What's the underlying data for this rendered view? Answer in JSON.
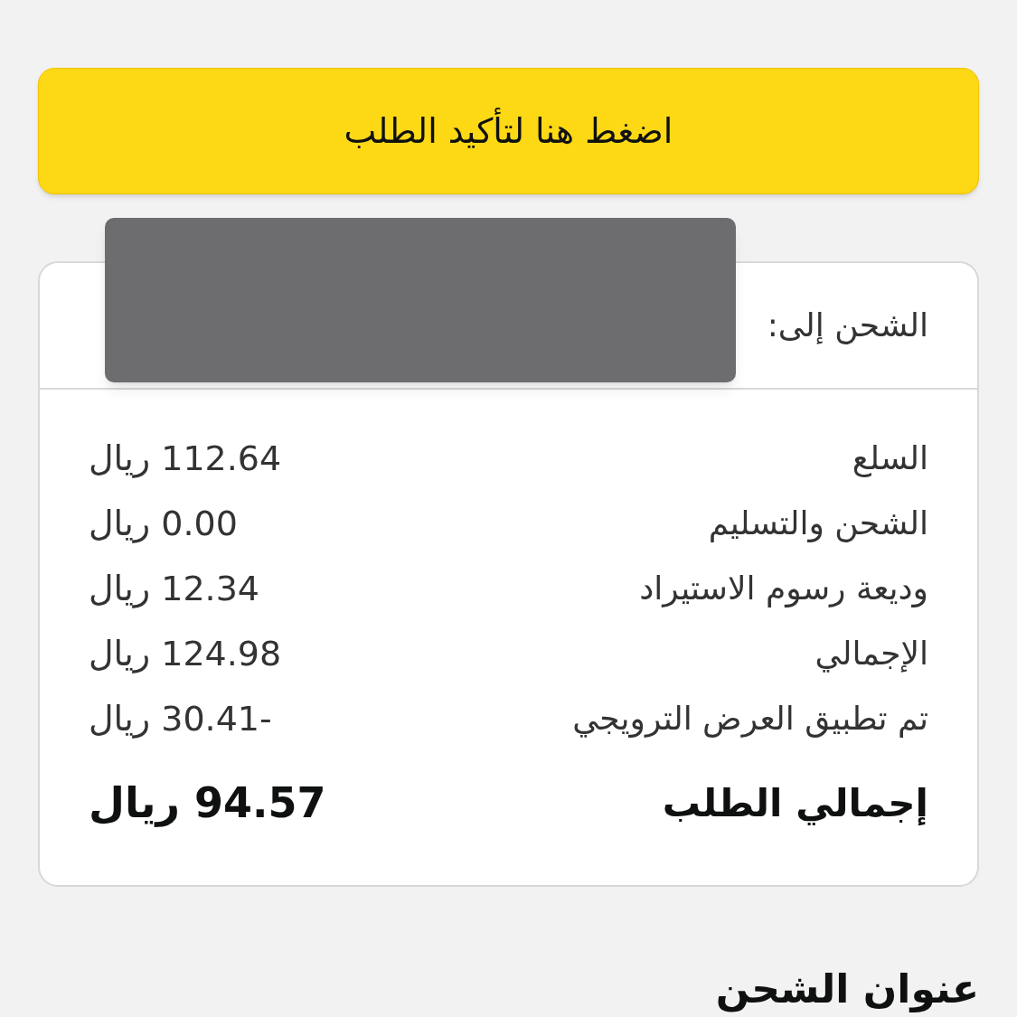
{
  "confirm_button": {
    "label": "اضغط هنا لتأكيد الطلب"
  },
  "summary": {
    "ship_to_label": "الشحن إلى:",
    "redacted": true,
    "rows": [
      {
        "label": "السلع",
        "value": "112.64 ريال"
      },
      {
        "label": "الشحن والتسليم",
        "value": "0.00 ريال"
      },
      {
        "label": "وديعة رسوم الاستيراد",
        "value": "12.34 ريال"
      },
      {
        "label": "الإجمالي",
        "value": "124.98 ريال"
      },
      {
        "label": "تم تطبيق العرض الترويجي",
        "value": "-30.41 ريال"
      }
    ],
    "total": {
      "label": "إجمالي الطلب",
      "value": "94.57 ريال"
    }
  },
  "shipping_address_heading": "عنوان الشحن"
}
